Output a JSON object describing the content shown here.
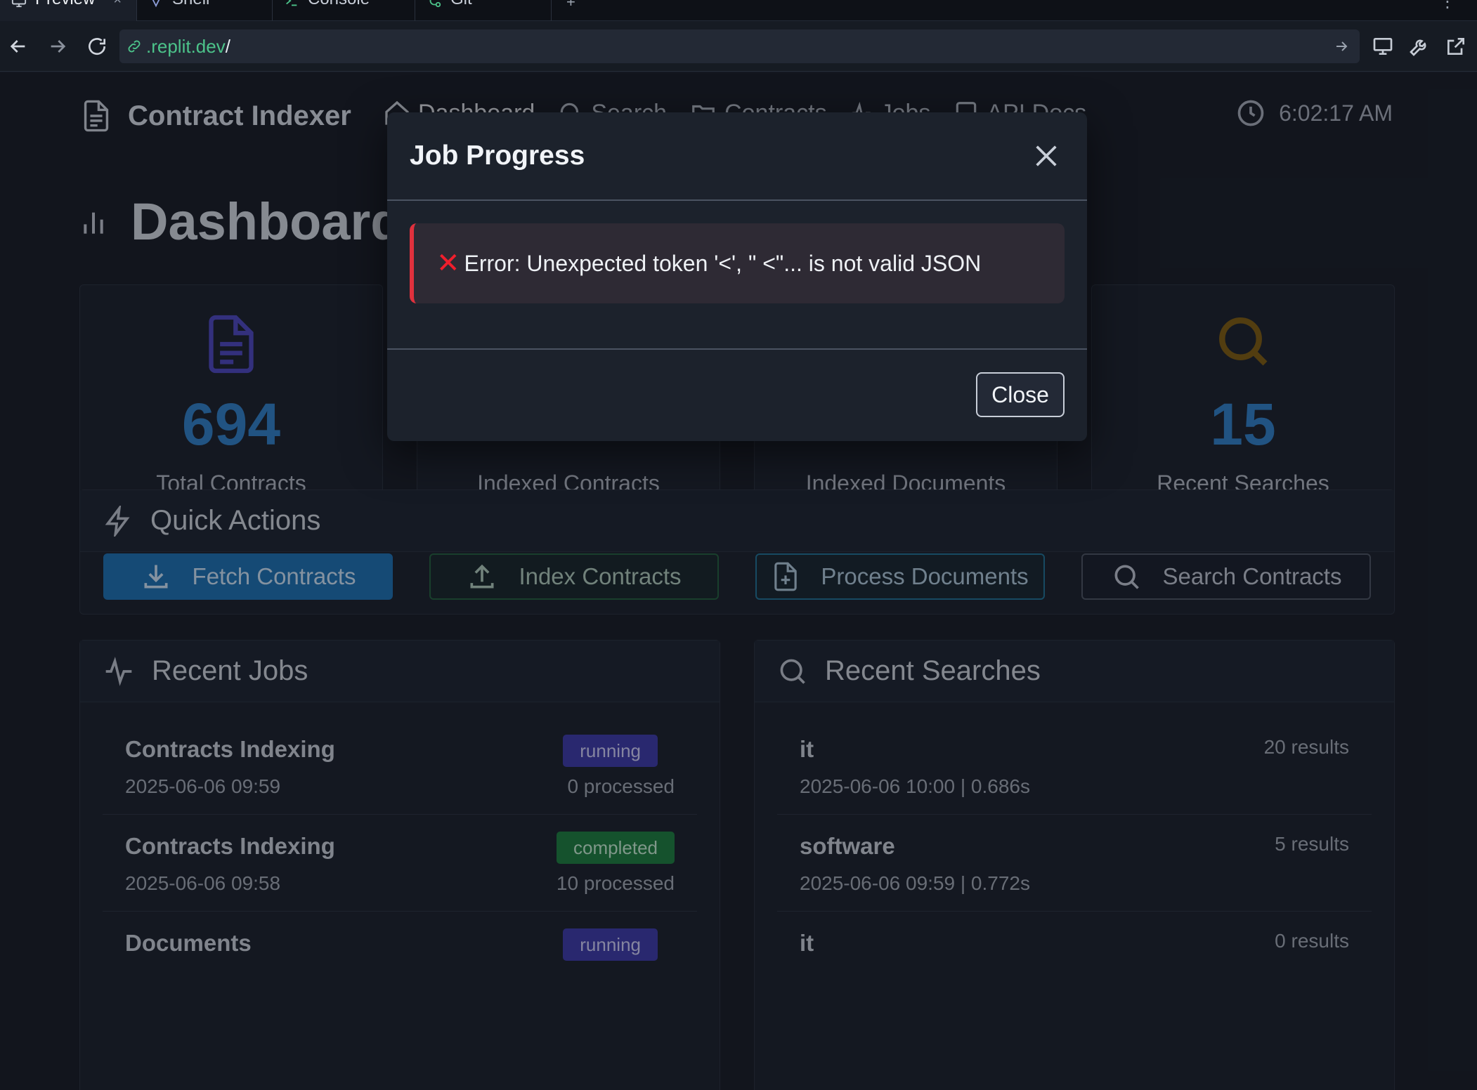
{
  "browser": {
    "tabs": [
      {
        "label": "Preview"
      },
      {
        "label": "Shell"
      },
      {
        "label": "Console"
      },
      {
        "label": "Git"
      }
    ],
    "tab_close": "×",
    "tab_add": "+",
    "tab_more": "⋮",
    "url_host": ".replit.dev",
    "url_path": "/"
  },
  "app": {
    "brand": "Contract Indexer",
    "nav": [
      {
        "label": "Dashboard"
      },
      {
        "label": "Search"
      },
      {
        "label": "Contracts"
      },
      {
        "label": "Jobs"
      },
      {
        "label": "API Docs"
      }
    ],
    "clock": "6:02:17 AM",
    "page_title": "Dashboard"
  },
  "stats": [
    {
      "value": "694",
      "label": "Total Contracts"
    },
    {
      "value": "",
      "label": "Indexed Contracts"
    },
    {
      "value": "",
      "label": "Indexed Documents"
    },
    {
      "value": "15",
      "label": "Recent Searches"
    }
  ],
  "quick_actions": {
    "title": "Quick Actions",
    "fetch": "Fetch Contracts",
    "index": "Index Contracts",
    "process": "Process Documents",
    "search": "Search Contracts"
  },
  "recent_jobs": {
    "title": "Recent Jobs",
    "items": [
      {
        "name": "Contracts Indexing",
        "time": "2025-06-06 09:59",
        "status": "running",
        "processed": "0 processed"
      },
      {
        "name": "Contracts Indexing",
        "time": "2025-06-06 09:58",
        "status": "completed",
        "processed": "10 processed"
      },
      {
        "name": "Documents",
        "time": "",
        "status": "running",
        "processed": ""
      }
    ]
  },
  "recent_searches": {
    "title": "Recent Searches",
    "items": [
      {
        "query": "it",
        "meta": "2025-06-06 10:00 | 0.686s",
        "results": "20 results"
      },
      {
        "query": "software",
        "meta": "2025-06-06 09:59 | 0.772s",
        "results": "5 results"
      },
      {
        "query": "it",
        "meta": "",
        "results": "0 results"
      }
    ]
  },
  "modal": {
    "title": "Job Progress",
    "error_icon": "✕",
    "error": "Error: Unexpected token '<', \" <\"... is not valid JSON",
    "close_label": "Close"
  },
  "colors": {
    "accent": "#2f7bc0",
    "danger": "#e0313d",
    "running": "#3b39a3",
    "completed": "#1c7a3e"
  }
}
